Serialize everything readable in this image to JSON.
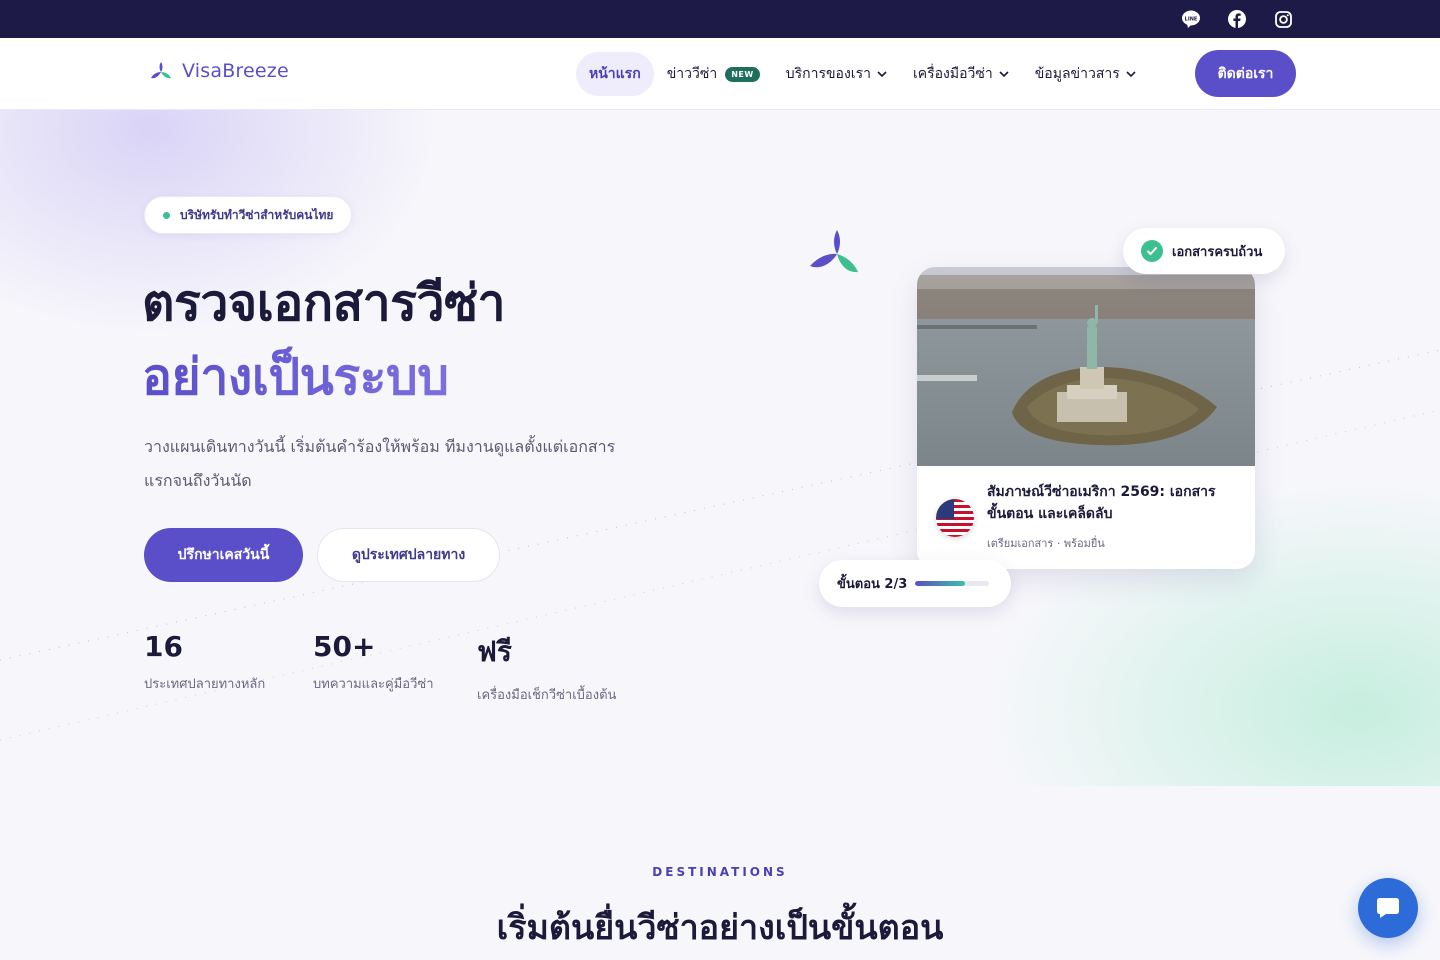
{
  "topbar": {
    "social": [
      {
        "icon": "line-icon",
        "label": "LINE"
      },
      {
        "icon": "facebook-icon"
      },
      {
        "icon": "instagram-icon"
      }
    ]
  },
  "header": {
    "logo_text": "VisaBreeze",
    "nav": [
      {
        "label": "หน้าแรก",
        "active": true
      },
      {
        "label": "ข่าววีซ่า",
        "badge": "NEW"
      },
      {
        "label": "บริการของเรา",
        "dropdown": true
      },
      {
        "label": "เครื่องมือวีซ่า",
        "dropdown": true
      },
      {
        "label": "ข้อมูลข่าวสาร",
        "dropdown": true
      }
    ],
    "contact_label": "ติดต่อเรา"
  },
  "hero": {
    "pill": "บริษัทรับทำวีซ่าสำหรับคนไทย",
    "title_line1": "ตรวจเอกสารวีซ่า",
    "title_line2": "อย่างเป็นระบบ",
    "lead": "วางแผนเดินทางวันนี้ เริ่มต้นคำร้องให้พร้อม ทีมงานดูแลตั้งแต่เอกสารแรกจนถึงวันนัด",
    "primary_cta": "ปรึกษาเคสวันนี้",
    "secondary_cta": "ดูประเทศปลายทาง",
    "stats": [
      {
        "value": "16",
        "label": "ประเทศปลายทางหลัก"
      },
      {
        "value": "50+",
        "label": "บทความและคู่มือวีซ่า"
      },
      {
        "value": "ฟรี",
        "label": "เครื่องมือเช็กวีซ่าเบื้องต้น"
      }
    ]
  },
  "card": {
    "title": "สัมภาษณ์วีซ่าอเมริกา 2569: เอกสาร ขั้นตอน และเคล็ดลับ",
    "meta": "เตรียมเอกสาร · พร้อมยื่น",
    "flag": "us-flag-icon",
    "doc_badge": "เอกสารครบถ้วน",
    "step_label": "ขั้นตอน 2/3",
    "step_progress": 0.67
  },
  "section": {
    "eyebrow": "DESTINATIONS",
    "title": "เริ่มต้นยื่นวีซ่าอย่างเป็นขั้นตอน"
  },
  "colors": {
    "brand": "#5b4fc9",
    "topbar": "#1d1a47",
    "accent_green": "#3ebf8f",
    "chat": "#2d6bd8"
  }
}
